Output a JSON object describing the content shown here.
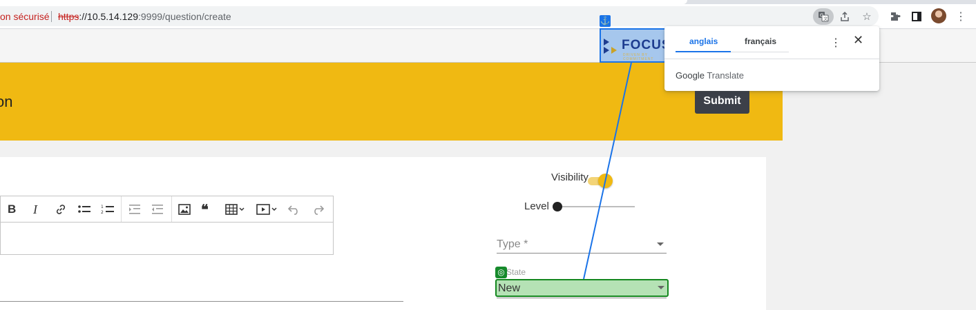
{
  "browser": {
    "security_text": "on sécurisé",
    "url_scheme": "https",
    "url_rest": "://10.5.14.129",
    "url_port_path": ":9999/question/create"
  },
  "page": {
    "banner_title": "on",
    "submit_label": "Submit",
    "visibility_label": "Visibility",
    "visibility_on": true,
    "level_label": "Level",
    "level_value": 0,
    "type_placeholder": "Type *",
    "status_label": "State",
    "status_value": "New",
    "accent_color": "#f0b912"
  },
  "translate_popup": {
    "tab_source": "anglais",
    "tab_target": "français",
    "google": "Google",
    "translate": "Translate"
  },
  "overlay": {
    "logo_text": "FOCUS",
    "logo_subtext": "DRIVEN BY COMMITMENT"
  }
}
